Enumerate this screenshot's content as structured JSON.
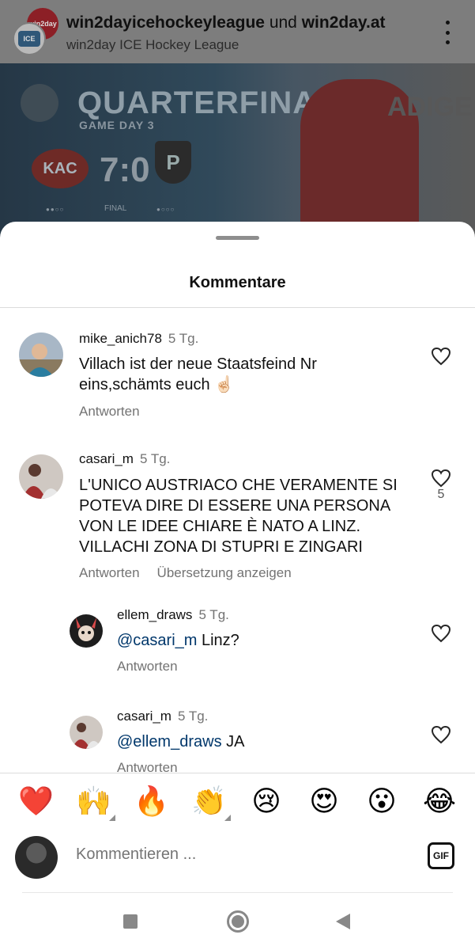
{
  "post": {
    "author_primary": "win2dayicehockeyleague",
    "author_connector": "und",
    "author_secondary": "win2day.at",
    "subtitle": "win2day ICE Hockey League",
    "avatar_back_text": "win2day",
    "avatar_front_text": "ICE"
  },
  "banner": {
    "title": "QUARTERFINALS",
    "game_day": "GAME DAY 3",
    "team_home": "KAC",
    "score": "7:0",
    "team_away": "P",
    "status": "FINAL",
    "sponsor_text": "ADIGE",
    "series_home": "●●○○",
    "series_away": "●○○○"
  },
  "sheet": {
    "title": "Kommentare"
  },
  "comments": [
    {
      "username": "mike_anich78",
      "time": "5 Tg.",
      "text": "Villach ist der neue Staatsfeind Nr eins,schämts euch ☝🏻",
      "reply_label": "Antworten",
      "translate_label": "",
      "likes": ""
    },
    {
      "username": "casari_m",
      "time": "5 Tg.",
      "text": "L'UNICO AUSTRIACO CHE VERAMENTE SI POTEVA DIRE DI ESSERE UNA PERSONA VON LE IDEE CHIARE È NATO A LINZ. VILLACHI ZONA DI STUPRI E ZINGARI",
      "reply_label": "Antworten",
      "translate_label": "Übersetzung anzeigen",
      "likes": "5"
    },
    {
      "username": "ellem_draws",
      "time": "5 Tg.",
      "mention": "@casari_m",
      "text": " Linz?",
      "reply_label": "Antworten"
    },
    {
      "username": "casari_m",
      "time": "5 Tg.",
      "mention": "@ellem_draws",
      "text": " JA",
      "reply_label": "Antworten"
    }
  ],
  "emoji_bar": {
    "items": [
      "❤️",
      "🙌",
      "🔥",
      "👏",
      "😢",
      "😍",
      "😮",
      "😂"
    ]
  },
  "compose": {
    "placeholder": "Kommentieren ...",
    "gif_label": "GIF"
  },
  "colors": {
    "mention": "#00376b",
    "secondary_text": "#737373"
  }
}
